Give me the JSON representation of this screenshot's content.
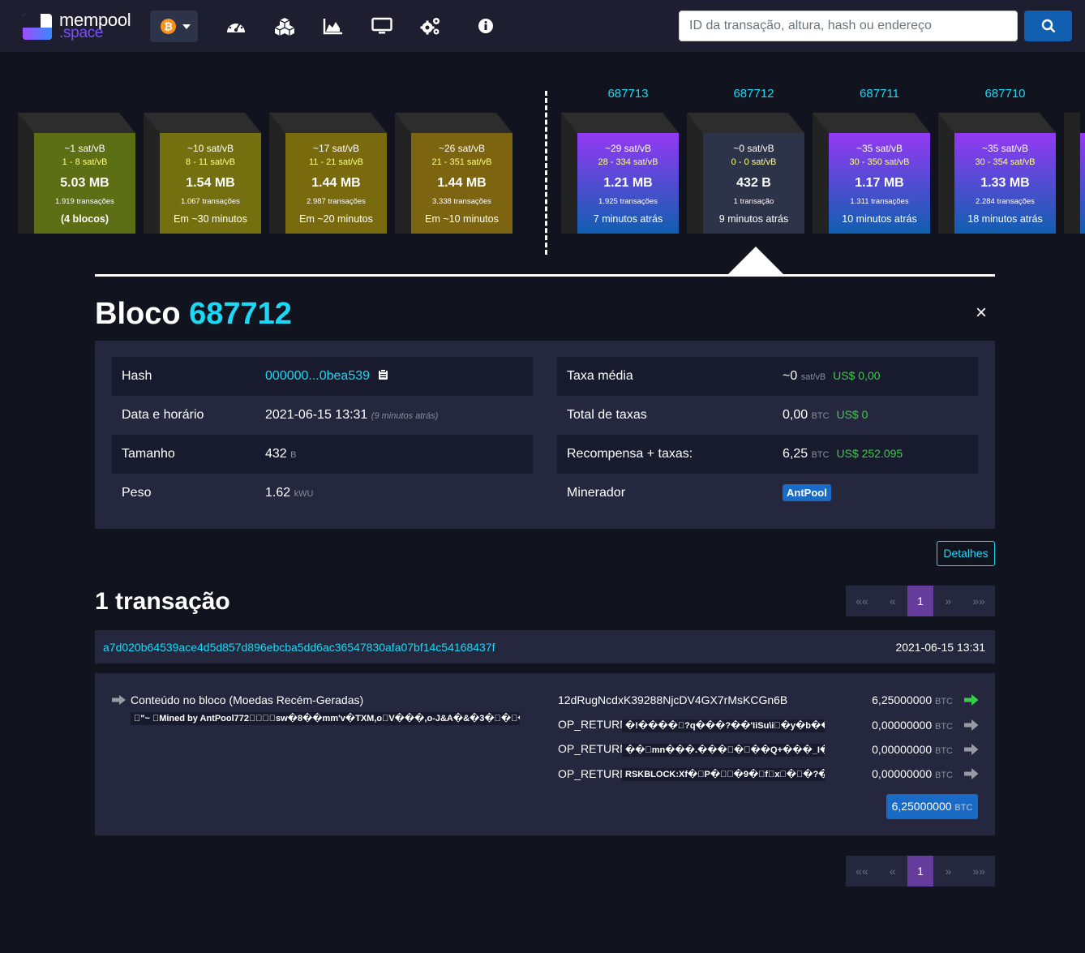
{
  "navbar": {
    "logo_line1": "mempool",
    "logo_line2": ".space",
    "network_icon": "bitcoin-icon",
    "search_placeholder": "ID da transação, altura, hash ou endereço",
    "icons": [
      "dashboard-icon",
      "blocks-icon",
      "graphs-icon",
      "tv-icon",
      "api-icon",
      "about-icon"
    ]
  },
  "mempool_blocks": [
    {
      "fee": "~1 sat/vB",
      "range": "1 - 8 sat/vB",
      "size": "5.03 MB",
      "txs": "1.919 transações",
      "eta": "(4 blocos)",
      "color": "#5d6f14"
    },
    {
      "fee": "~10 sat/vB",
      "range": "8 - 11 sat/vB",
      "size": "1.54 MB",
      "txs": "1.067 transações",
      "eta": "Em ~30 minutos",
      "color": "#75700f"
    },
    {
      "fee": "~17 sat/vB",
      "range": "11 - 21 sat/vB",
      "size": "1.44 MB",
      "txs": "2.987 transações",
      "eta": "Em ~20 minutos",
      "color": "#7a6a0e"
    },
    {
      "fee": "~26 sat/vB",
      "range": "21 - 351 sat/vB",
      "size": "1.44 MB",
      "txs": "3.338 transações",
      "eta": "Em ~10 minutos",
      "color": "#7d6410"
    }
  ],
  "blocks": [
    {
      "height": "687713",
      "fee": "~29 sat/vB",
      "range": "28 - 334 sat/vB",
      "size": "1.21 MB",
      "txs": "1.925 transações",
      "eta": "7 minutos atrás"
    },
    {
      "height": "687712",
      "fee": "~0 sat/vB",
      "range": "0 - 0 sat/vB",
      "size": "432 B",
      "txs": "1 transação",
      "eta": "9 minutos atrás"
    },
    {
      "height": "687711",
      "fee": "~35 sat/vB",
      "range": "30 - 350 sat/vB",
      "size": "1.17 MB",
      "txs": "1.311 transações",
      "eta": "10 minutos atrás"
    },
    {
      "height": "687710",
      "fee": "~35 sat/vB",
      "range": "30 - 354 sat/vB",
      "size": "1.33 MB",
      "txs": "2.284 transações",
      "eta": "18 minutos atrás"
    }
  ],
  "block": {
    "title_prefix": "Bloco",
    "height": "687712",
    "close": "×",
    "hash_label": "Hash",
    "hash": "000000...0bea539",
    "date_label": "Data e horário",
    "date": "2021-06-15 13:31",
    "date_ago": "(9 minutos atrás)",
    "size_label": "Tamanho",
    "size": "432",
    "size_unit": "B",
    "weight_label": "Peso",
    "weight": "1.62",
    "weight_unit": "kWU",
    "median_fee_label": "Taxa média",
    "median_fee": "~0",
    "median_fee_unit": "sat/vB",
    "median_fee_usd": "US$ 0,00",
    "total_fees_label": "Total de taxas",
    "total_fees": "0,00",
    "total_fees_unit": "BTC",
    "total_fees_usd": "US$ 0",
    "reward_label": "Recompensa + taxas:",
    "reward": "6,25",
    "reward_unit": "BTC",
    "reward_usd": "US$ 252.095",
    "miner_label": "Minerador",
    "miner": "AntPool",
    "details_button": "Detalhes"
  },
  "transactions": {
    "count_title": "1 transação",
    "pagination": [
      "««",
      "«",
      "1",
      "»",
      "»»"
    ],
    "tx": {
      "txid": "a7d020b64539ace4d5d857d896ebcba5dd6ac36547830afa07bf14c54168437f",
      "time": "2021-06-15 13:31",
      "input_label": "Conteúdo no bloco (Moedas Recém-Geradas)",
      "coinbase_script": "\u0000\"~ \u0000Mined by AntPool772\u0000\u0000\u0000\u0000sw�8��mm'v�TXM,o\u0000V���,o-J&A�&�3�\u0000�\u0000��#@...",
      "outputs": [
        {
          "label": "12dRugNcdxK39288NjcDV4GX7rMsKCGn6B",
          "script": "",
          "amount": "6,25000000",
          "unit": "BTC",
          "link": true
        },
        {
          "label": "OP_RETURN",
          "script": "�!����\u0000?q���?��'IiSu\\i\u0000�y�b����...",
          "amount": "0,00000000",
          "unit": "BTC",
          "link": false
        },
        {
          "label": "OP_RETURN",
          "script": "��\u0000mn���.���\u0000�\u0000��Q+���_I�Y�...",
          "amount": "0,00000000",
          "unit": "BTC",
          "link": false
        },
        {
          "label": "OP_RETURN",
          "script": "RSKBLOCK:Xf�\u0000P�\u0000\u0000�9�\u0000f\u0000x\u0000�\u0000�?��:\\...",
          "amount": "0,00000000",
          "unit": "BTC",
          "link": false
        }
      ],
      "total": "6,25000000",
      "total_unit": "BTC"
    }
  },
  "colors": {
    "accent": "#1bd8f4",
    "mined_top": "#9339f4",
    "mined_bottom": "#105fb0",
    "usd": "#3bcc49",
    "page_active": "#653b9c"
  }
}
